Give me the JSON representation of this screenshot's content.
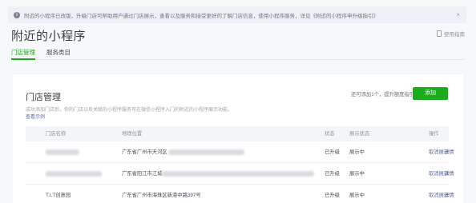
{
  "notice": {
    "text": "附近的小程序已改版，升级门店可帮助用户通过门店展示，查看以及服务和接受更好的了解门店信息，使用小程序服务，详见《附近的小程序申升级指引》",
    "close": "×"
  },
  "page_title": "附近的小程序",
  "help_link": "使用指南",
  "tabs": [
    {
      "label": "门店管理",
      "active": true
    },
    {
      "label": "服务类目",
      "active": false
    }
  ],
  "card": {
    "title": "门店管理",
    "description": "成功添加门店后，你的门店以及关联的小程序服务可在微信小程序入门的附近的小程序展示功能。",
    "example_link": "查看示例",
    "quota": "还可添加1个，提升额度指引",
    "add_button": "添加"
  },
  "table": {
    "headers": [
      "门店名称",
      "地理位置",
      "状态",
      "展示状态",
      "操作"
    ],
    "rows": [
      {
        "name": "",
        "location": "广东省广州市天河区",
        "status": "已升级",
        "display": "展示中",
        "action1": "取消展示",
        "action2": "详情"
      },
      {
        "name": "",
        "location": "广东省阳江市江城",
        "status": "已升级",
        "display": "展示中",
        "action1": "取消展示",
        "action2": "详情"
      },
      {
        "name": "T.I.T创意园",
        "location": "广东省广州市海珠区新港中路397号",
        "status": "已升级",
        "display": "展示中",
        "action1": "取消展示",
        "action2": "详情"
      }
    ]
  },
  "colors": {
    "accent": "#1aad19",
    "link": "#576b95"
  }
}
